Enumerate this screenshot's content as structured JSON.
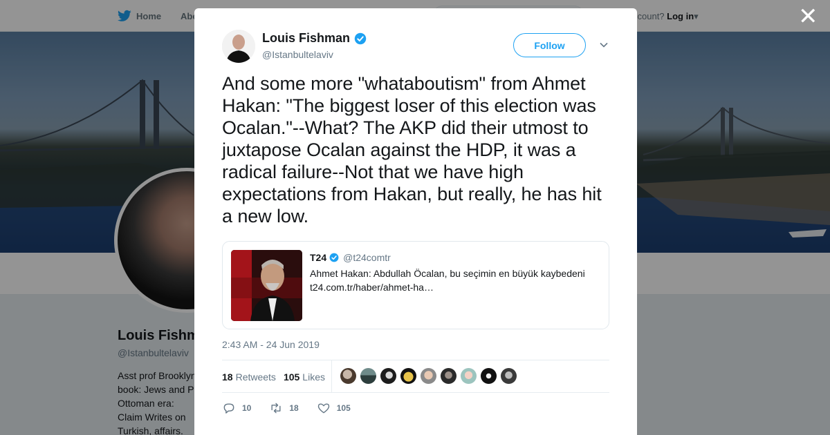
{
  "background": {
    "nav": {
      "home": "Home",
      "about": "Abo",
      "login_prefix": "ccount?",
      "login": "Log in"
    },
    "profile": {
      "name": "Louis Fishm",
      "handle": "@Istanbultelaviv",
      "bio": "Asst prof Brooklyn book: Jews and P Ottoman era: Claim Writes on Turkish, affairs."
    }
  },
  "tweet": {
    "author": {
      "name": "Louis Fishman",
      "handle": "@Istanbultelaviv",
      "verified": true
    },
    "follow_label": "Follow",
    "text": "And some more \"whataboutism\" from Ahmet Hakan: \"The biggest loser of this election was Ocalan.\"--What? The AKP did their utmost to juxtapose Ocalan against the HDP, it was a radical failure--Not that we have high expectations from Hakan, but really, he has hit a new low.",
    "quote": {
      "name": "T24",
      "handle": "@t24comtr",
      "verified": true,
      "text": "Ahmet Hakan: Abdullah Öcalan, bu seçimin en büyük kaybedeni t24.com.tr/haber/ahmet-ha…"
    },
    "timestamp": "2:43 AM - 24 Jun 2019",
    "stats": {
      "retweets_count": "18",
      "retweets_label": "Retweets",
      "likes_count": "105",
      "likes_label": "Likes"
    },
    "actions": {
      "replies": "10",
      "retweets": "18",
      "likes": "105"
    }
  },
  "colors": {
    "accent": "#1da1f2",
    "text": "#14171a",
    "muted": "#657786"
  },
  "icons": [
    "twitter-bird-icon",
    "verified-badge-icon",
    "chevron-down-icon",
    "close-icon",
    "reply-icon",
    "retweet-icon",
    "like-icon"
  ]
}
